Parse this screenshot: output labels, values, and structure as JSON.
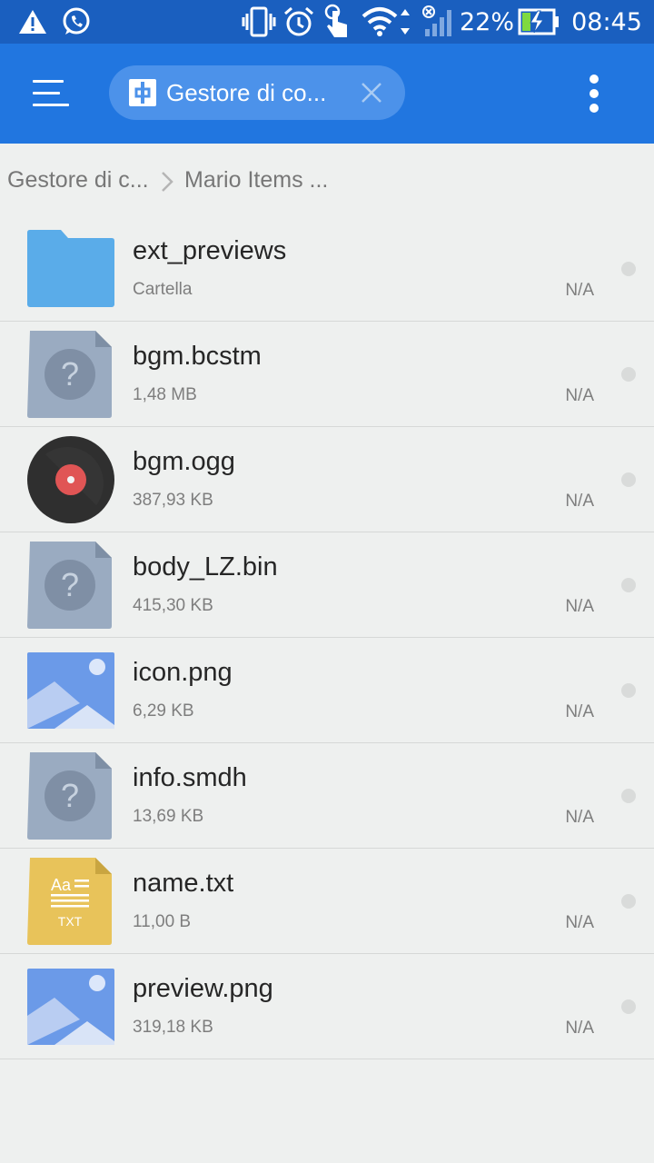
{
  "status_bar": {
    "battery": "22%",
    "time": "08:45",
    "icons": [
      "warning-icon",
      "whatsapp-icon",
      "vibrate-icon",
      "alarm-icon",
      "touch-icon",
      "wifi-icon",
      "signal-icon",
      "battery-charging-icon"
    ]
  },
  "app_bar": {
    "tab_title": "Gestore di co...",
    "tab_icon": "app-manager-icon"
  },
  "breadcrumb": {
    "items": [
      "Gestore di c...",
      "Mario Items ..."
    ]
  },
  "files": [
    {
      "name": "ext_previews",
      "size": "Cartella",
      "date": "N/A",
      "icon": "folder"
    },
    {
      "name": "bgm.bcstm",
      "size": "1,48 MB",
      "date": "N/A",
      "icon": "unknown"
    },
    {
      "name": "bgm.ogg",
      "size": "387,93 KB",
      "date": "N/A",
      "icon": "audio"
    },
    {
      "name": "body_LZ.bin",
      "size": "415,30 KB",
      "date": "N/A",
      "icon": "unknown"
    },
    {
      "name": "icon.png",
      "size": "6,29 KB",
      "date": "N/A",
      "icon": "image"
    },
    {
      "name": "info.smdh",
      "size": "13,69 KB",
      "date": "N/A",
      "icon": "unknown"
    },
    {
      "name": "name.txt",
      "size": "11,00 B",
      "date": "N/A",
      "icon": "text",
      "icon_label_top": "Aa",
      "icon_label_bottom": "TXT"
    },
    {
      "name": "preview.png",
      "size": "319,18 KB",
      "date": "N/A",
      "icon": "image"
    }
  ],
  "colors": {
    "status_bar": "#1a5fbf",
    "app_bar": "#2176e0",
    "background": "#eef0ef",
    "folder": "#5aace9"
  }
}
